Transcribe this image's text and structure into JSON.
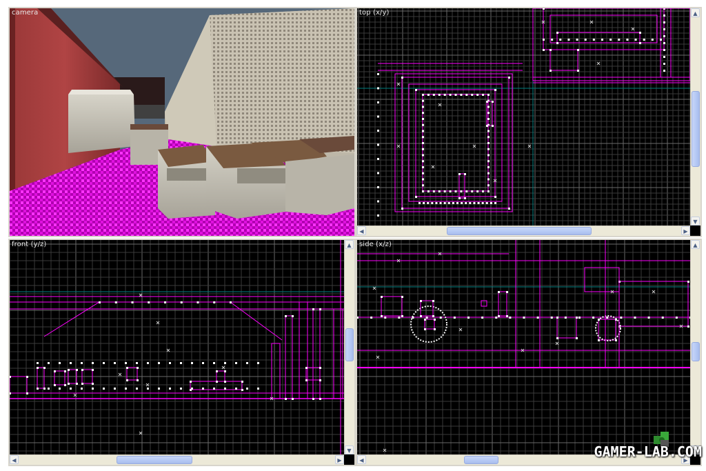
{
  "viewports": {
    "camera": {
      "label": "camera"
    },
    "top": {
      "label": "top (x/y)"
    },
    "front": {
      "label": "front (y/z)"
    },
    "side": {
      "label": "side (x/z)"
    }
  },
  "colors": {
    "brush": "#ff00ff",
    "grid_minor": "#3a3a3a",
    "grid_major": "#6a6a6a",
    "axis": "#008080",
    "vertex": "#ffffff",
    "floor_pink": "#cc00cc",
    "wall_red": "#8a3030",
    "sky": "#5a6a78"
  },
  "icons": {
    "up_arrow": "▲",
    "down_arrow": "▼",
    "left_arrow": "◀",
    "right_arrow": "▶"
  },
  "watermark": {
    "text": "GAMER-LAB.COM"
  }
}
